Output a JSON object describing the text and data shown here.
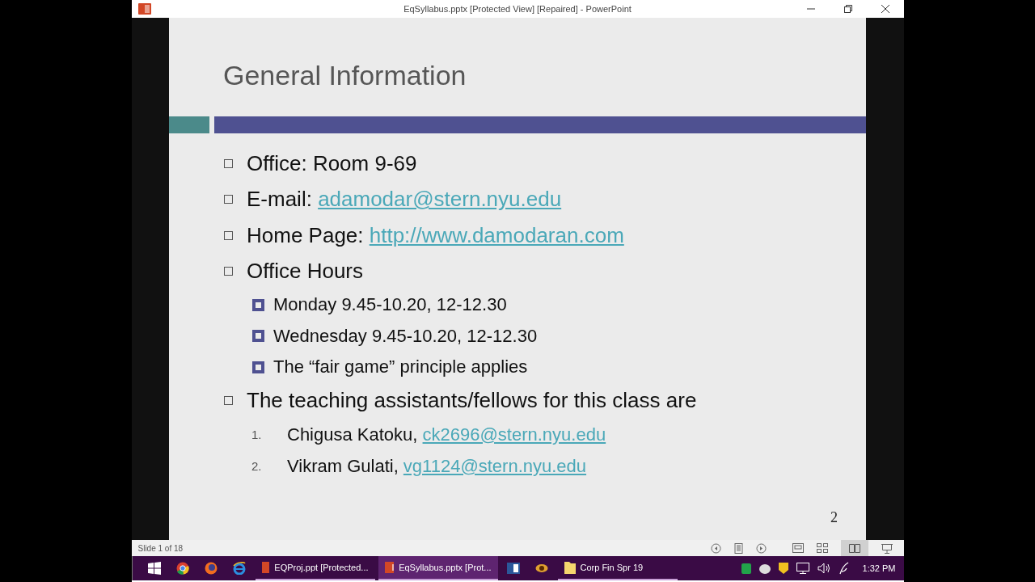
{
  "window": {
    "title": "EqSyllabus.pptx [Protected View] [Repaired] - PowerPoint"
  },
  "slide": {
    "title": "General Information",
    "page_number": "2",
    "items": [
      {
        "text": "Office: Room 9-69"
      },
      {
        "text": "E-mail: ",
        "link": "adamodar@stern.nyu.edu"
      },
      {
        "text": "Home Page: ",
        "link": "http://www.damodaran.com"
      },
      {
        "text": "Office Hours",
        "children": [
          {
            "kind": "bullet",
            "text": "Monday 9.45-10.20, 12-12.30"
          },
          {
            "kind": "bullet",
            "text": "Wednesday 9.45-10.20, 12-12.30"
          },
          {
            "kind": "bullet",
            "text": "The “fair game” principle applies"
          }
        ]
      },
      {
        "text": "The teaching assistants/fellows for this class are",
        "children": [
          {
            "kind": "numbered",
            "number": "1.",
            "text": "Chigusa Katoku, ",
            "link": "ck2696@stern.nyu.edu"
          },
          {
            "kind": "numbered",
            "number": "2.",
            "text": "Vikram Gulati, ",
            "link": "vg1124@stern.nyu.edu"
          }
        ]
      }
    ]
  },
  "status_bar": {
    "slide_counter": "Slide 1 of 18"
  },
  "taskbar": {
    "items": [
      {
        "kind": "pinned"
      },
      {
        "kind": "pinned"
      },
      {
        "kind": "pinned"
      },
      {
        "kind": "pinned"
      },
      {
        "kind": "window",
        "label": "EQProj.ppt [Protected...",
        "selected": false
      },
      {
        "kind": "window",
        "label": "EqSyllabus.pptx [Prot...",
        "selected": true
      },
      {
        "kind": "pinned"
      },
      {
        "kind": "pinned"
      },
      {
        "kind": "window",
        "label": "Corp Fin Spr 19",
        "selected": false
      }
    ],
    "time": "1:32 PM"
  }
}
